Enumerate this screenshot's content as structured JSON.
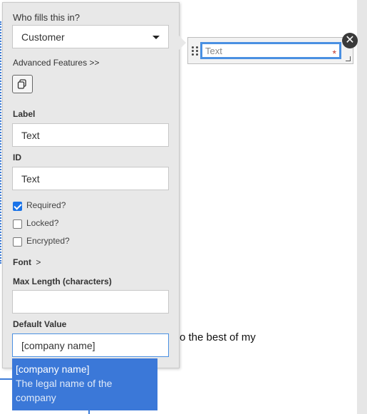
{
  "panel": {
    "who_fills_label": "Who fills this in?",
    "who_fills_value": "Customer",
    "advanced_link": "Advanced Features >>",
    "label_heading": "Label",
    "label_value": "Text",
    "id_heading": "ID",
    "id_value": "Text",
    "checkboxes": [
      {
        "label": "Required?",
        "checked": true
      },
      {
        "label": "Locked?",
        "checked": false
      },
      {
        "label": "Encrypted?",
        "checked": false
      }
    ],
    "font_label": "Font",
    "font_chevron": ">",
    "max_length_label": "Max Length (characters)",
    "max_length_value": "",
    "default_value_label": "Default Value",
    "default_value": "[company name]"
  },
  "autocomplete": {
    "token": "[company name]",
    "description": "The legal name of the company"
  },
  "field_widget": {
    "placeholder": "Text",
    "required_mark": "*",
    "close_glyph": "✕"
  },
  "document": {
    "visible_text": "o the best of my"
  },
  "colors": {
    "accent": "#4a90e2",
    "highlight": "#3b78d8",
    "required": "#c0392b"
  }
}
